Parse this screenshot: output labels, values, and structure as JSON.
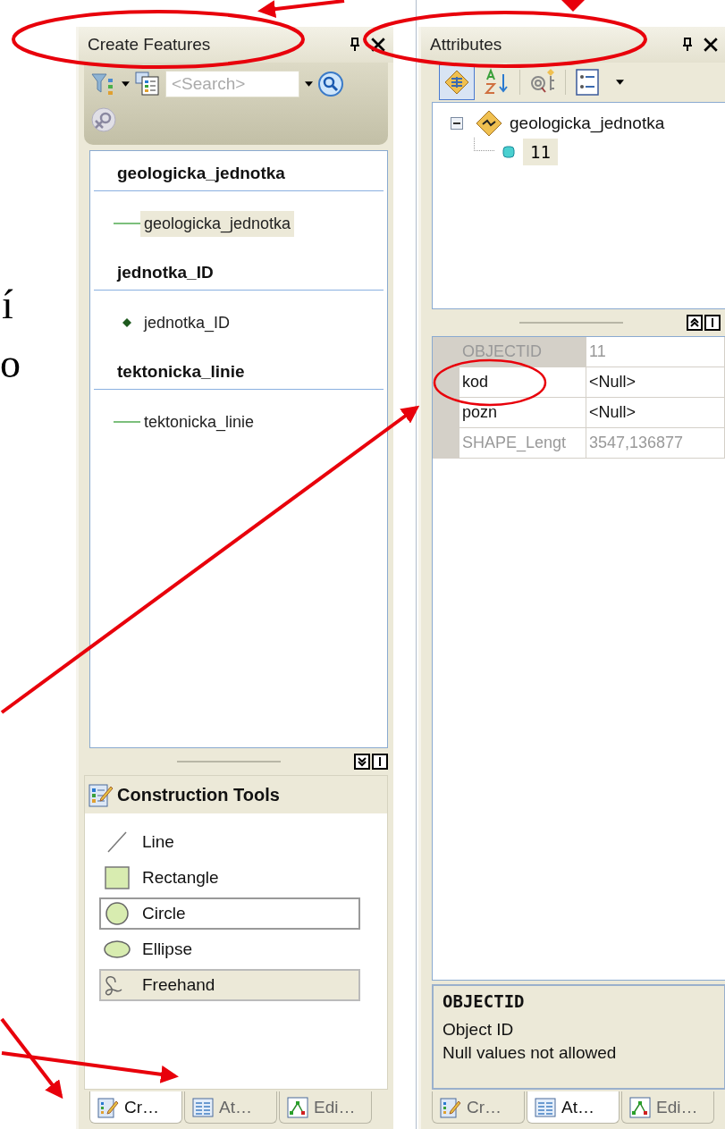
{
  "slide_text_fragments": [
    "í",
    "o"
  ],
  "create_features": {
    "title": "Create Features",
    "search": {
      "placeholder": "<Search>"
    },
    "templates": [
      {
        "layer": "geologicka_jednotka",
        "items": [
          {
            "label": "geologicka_jednotka",
            "kind": "line",
            "selected": true
          }
        ]
      },
      {
        "layer": "jednotka_ID",
        "items": [
          {
            "label": "jednotka_ID",
            "kind": "point",
            "selected": false
          }
        ]
      },
      {
        "layer": "tektonicka_linie",
        "items": [
          {
            "label": "tektonicka_linie",
            "kind": "line",
            "selected": false
          }
        ]
      }
    ],
    "construction_tools": {
      "title": "Construction Tools",
      "tools": [
        {
          "label": "Line",
          "kind": "line",
          "selected": false,
          "focused": false
        },
        {
          "label": "Rectangle",
          "kind": "rectangle",
          "selected": false,
          "focused": false
        },
        {
          "label": "Circle",
          "kind": "circle",
          "selected": false,
          "focused": true
        },
        {
          "label": "Ellipse",
          "kind": "ellipse",
          "selected": false,
          "focused": false
        },
        {
          "label": "Freehand",
          "kind": "freehand",
          "selected": true,
          "focused": false
        }
      ]
    },
    "tabs": [
      {
        "label": "Cr…",
        "kind": "create",
        "selected": true
      },
      {
        "label": "At…",
        "kind": "attributes",
        "selected": false
      },
      {
        "label": "Edi…",
        "kind": "edit",
        "selected": false
      }
    ]
  },
  "attributes": {
    "title": "Attributes",
    "tree": {
      "label": "geologicka_jednotka",
      "expanded": true,
      "children": [
        {
          "label": "11",
          "selected": true
        }
      ]
    },
    "properties": [
      {
        "field": "OBJECTID",
        "value": "11",
        "readonly": true,
        "selected": true
      },
      {
        "field": "kod",
        "value": "<Null>",
        "readonly": false,
        "selected": false
      },
      {
        "field": "pozn",
        "value": "<Null>",
        "readonly": false,
        "selected": false
      },
      {
        "field": "SHAPE_Lengt",
        "value": "3547,136877",
        "readonly": true,
        "selected": false
      }
    ],
    "description": {
      "title": "OBJECTID",
      "lines": [
        "Object ID",
        "Null values not allowed"
      ]
    },
    "tabs": [
      {
        "label": "Cr…",
        "kind": "create",
        "selected": false
      },
      {
        "label": "At…",
        "kind": "attributes",
        "selected": true
      },
      {
        "label": "Edi…",
        "kind": "edit",
        "selected": false
      }
    ]
  }
}
